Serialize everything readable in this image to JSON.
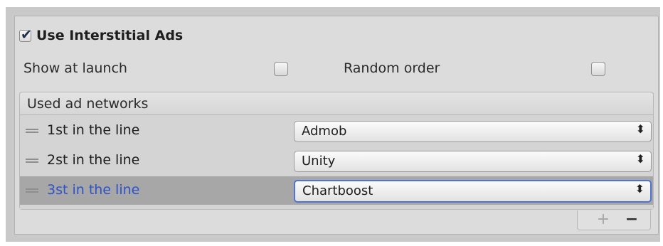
{
  "section": {
    "title": "Use Interstitial Ads",
    "enabled": true
  },
  "options": {
    "show_at_launch": {
      "label": "Show at launch",
      "checked": false
    },
    "random_order": {
      "label": "Random order",
      "checked": false
    }
  },
  "networks": {
    "header": "Used ad networks",
    "items": [
      {
        "label": "1st in the line",
        "value": "Admob"
      },
      {
        "label": "2st in the line",
        "value": "Unity"
      },
      {
        "label": "3st in the line",
        "value": "Chartboost"
      }
    ],
    "selected_index": 2,
    "select_arrow": "⬍",
    "add_label": "+",
    "remove_label": "−"
  },
  "icons": {
    "check": "check-icon",
    "drag": "drag-handle-icon",
    "dropdown": "dropdown-arrows-icon"
  },
  "colors": {
    "selected_row": "#a7a7a7",
    "selected_text": "#2d52c9",
    "focus_border": "#4f74d6"
  }
}
